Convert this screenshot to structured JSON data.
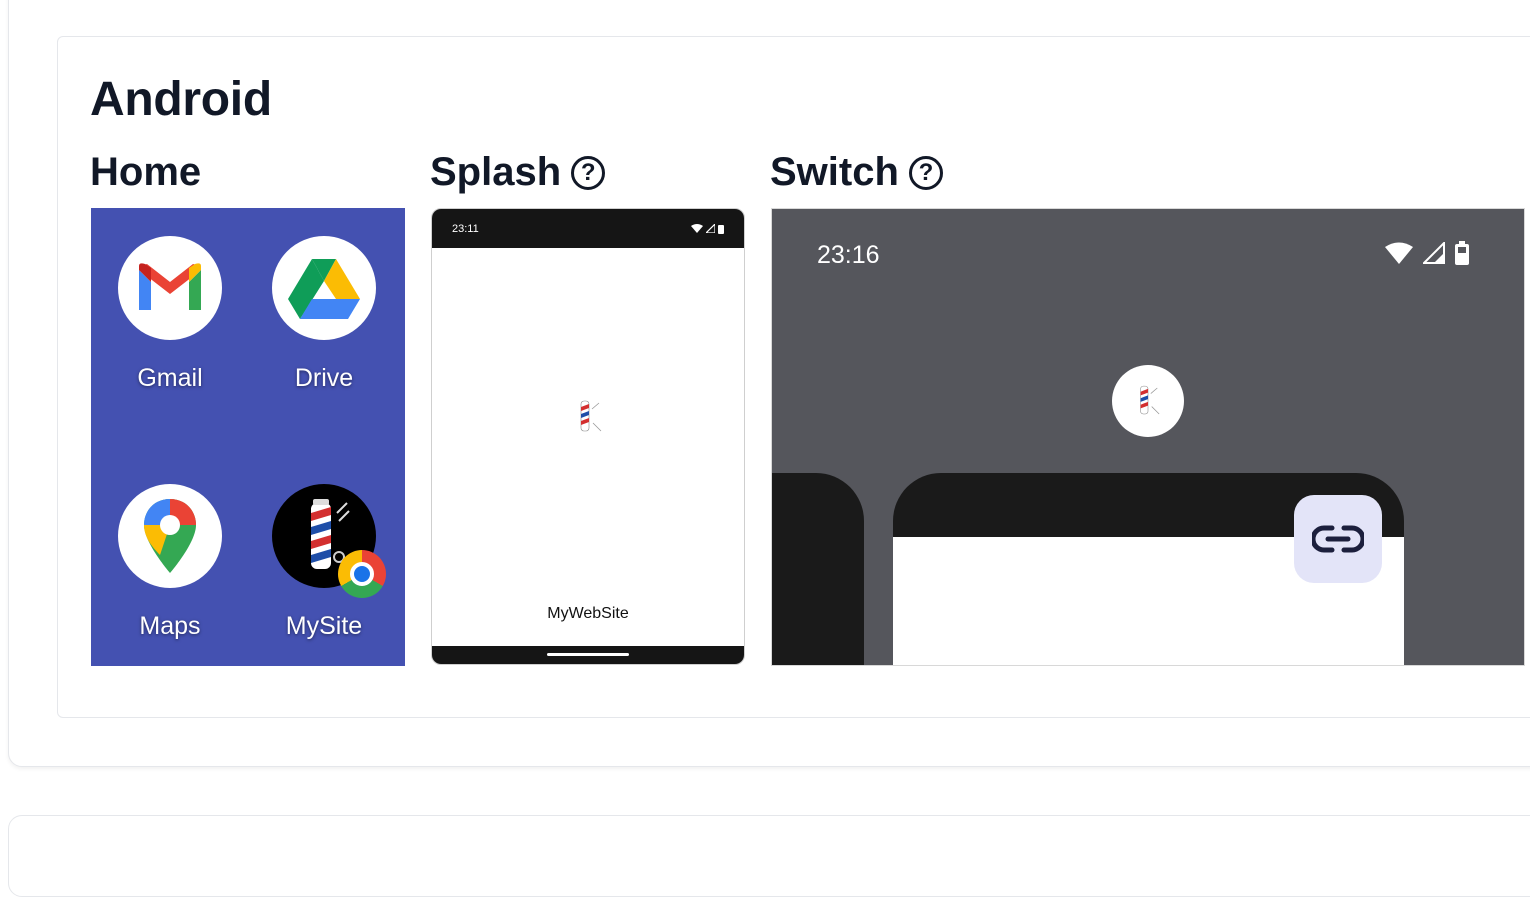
{
  "section": {
    "title": "Android"
  },
  "home": {
    "title": "Home",
    "apps": [
      {
        "label": "Gmail",
        "icon": "gmail-icon"
      },
      {
        "label": "Drive",
        "icon": "drive-icon"
      },
      {
        "label": "Maps",
        "icon": "maps-icon"
      },
      {
        "label": "MySite",
        "icon": "barber-pole-icon"
      }
    ],
    "background": "#4451b1"
  },
  "splash": {
    "title": "Splash",
    "help": "?",
    "time": "23:11",
    "app_name": "MyWebSite"
  },
  "switch": {
    "title": "Switch",
    "help": "?",
    "time": "23:16"
  }
}
